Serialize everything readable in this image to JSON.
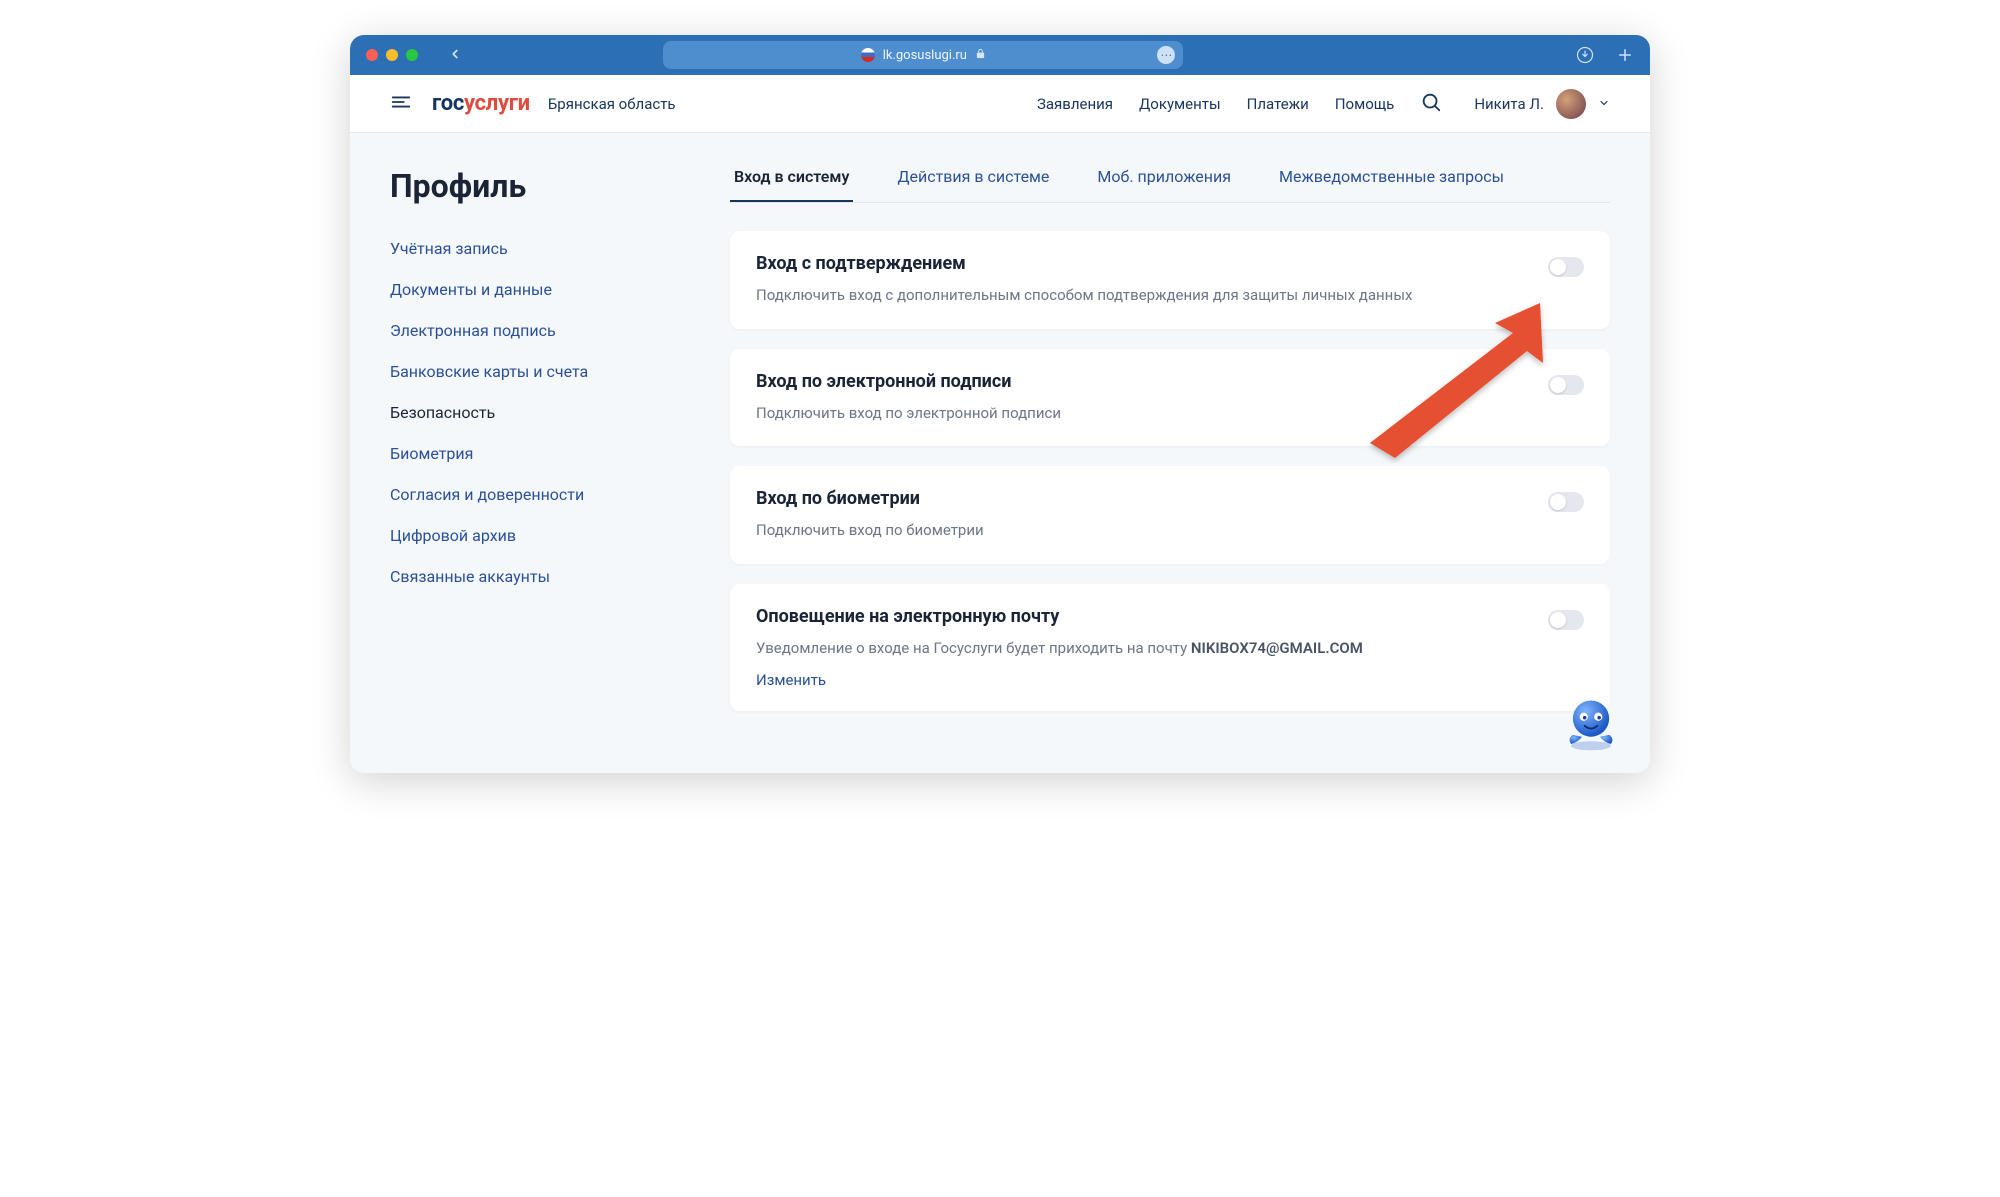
{
  "browser": {
    "url_host": "lk.gosuslugi.ru"
  },
  "header": {
    "logo_blue": "гос",
    "logo_red": "услуги",
    "region": "Брянская область",
    "nav": {
      "applications": "Заявления",
      "documents": "Документы",
      "payments": "Платежи",
      "help": "Помощь"
    },
    "user_name": "Никита Л."
  },
  "page": {
    "title": "Профиль"
  },
  "sidebar": {
    "items": [
      {
        "label": "Учётная запись",
        "active": false
      },
      {
        "label": "Документы и данные",
        "active": false
      },
      {
        "label": "Электронная подпись",
        "active": false
      },
      {
        "label": "Банковские карты и счета",
        "active": false
      },
      {
        "label": "Безопасность",
        "active": true
      },
      {
        "label": "Биометрия",
        "active": false
      },
      {
        "label": "Согласия и доверенности",
        "active": false
      },
      {
        "label": "Цифровой архив",
        "active": false
      },
      {
        "label": "Связанные аккаунты",
        "active": false
      }
    ]
  },
  "tabs": {
    "login": "Вход в систему",
    "activity": "Действия в системе",
    "mobile": "Моб. приложения",
    "interagency": "Межведомственные запросы"
  },
  "cards": {
    "confirm": {
      "title": "Вход с подтверждением",
      "desc": "Подключить вход с дополнительным способом подтверждения для защиты личных данных"
    },
    "esign": {
      "title": "Вход по электронной подписи",
      "desc": "Подключить вход по электронной подписи"
    },
    "bio": {
      "title": "Вход по биометрии",
      "desc": "Подключить вход по биометрии"
    },
    "email": {
      "title": "Оповещение на электронную почту",
      "desc_prefix": "Уведомление о входе на Госуслуги будет приходить на почту ",
      "email": "NIKIBOX74@GMAIL.COM",
      "change": "Изменить"
    }
  }
}
